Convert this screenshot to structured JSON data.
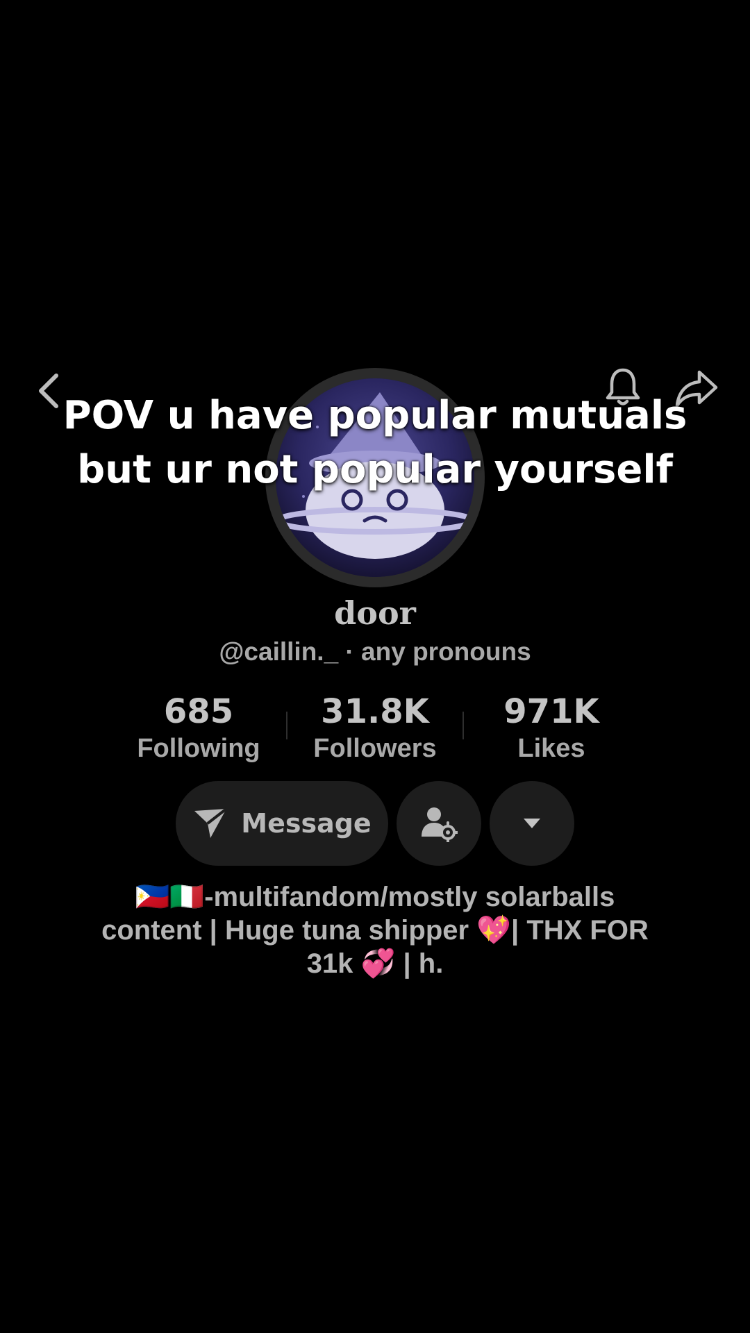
{
  "nav": {
    "back_icon": "chevron-left-icon",
    "bell_icon": "bell-icon",
    "share_icon": "share-icon"
  },
  "caption": {
    "line1": "POV u have popular mutuals",
    "line2": "but ur not popular yourself"
  },
  "profile": {
    "display_name": "door",
    "handle_line": "@caillin._ · any pronouns"
  },
  "stats": [
    {
      "value": "685",
      "label": "Following"
    },
    {
      "value": "31.8K",
      "label": "Followers"
    },
    {
      "value": "971K",
      "label": "Likes"
    }
  ],
  "actions": {
    "message_label": "Message",
    "message_icon": "send-icon",
    "friend_settings_icon": "user-settings-icon",
    "more_icon": "caret-down-icon"
  },
  "bio": {
    "line1": "🇵🇭🇮🇹-multifandom/mostly solarballs",
    "line2": "content | Huge tuna shipper 💖|  THX FOR",
    "line3": "31k 💞 | h."
  },
  "colors": {
    "background": "#000000",
    "button_bg": "#1d1d1d",
    "text_primary": "#c4c4c4",
    "text_secondary": "#a9a9a9",
    "caption_text": "#ffffff"
  }
}
